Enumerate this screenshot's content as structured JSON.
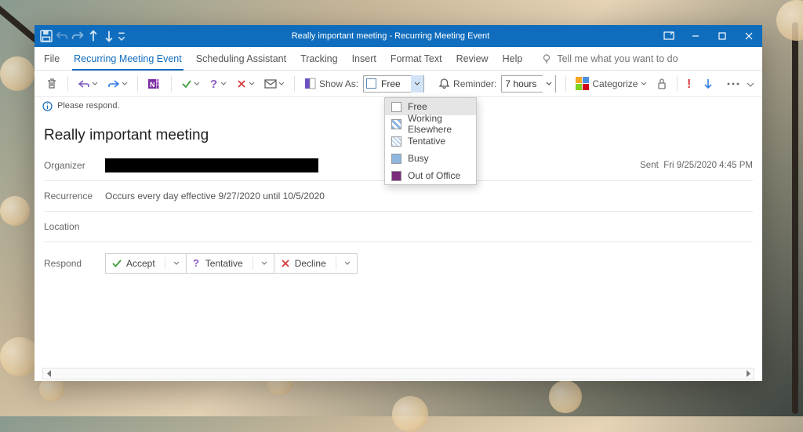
{
  "titlebar": {
    "title": "Really important meeting  -  Recurring Meeting Event"
  },
  "menubar": {
    "items": [
      {
        "label": "File"
      },
      {
        "label": "Recurring Meeting Event"
      },
      {
        "label": "Scheduling Assistant"
      },
      {
        "label": "Tracking"
      },
      {
        "label": "Insert"
      },
      {
        "label": "Format Text"
      },
      {
        "label": "Review"
      },
      {
        "label": "Help"
      }
    ],
    "tell_me_placeholder": "Tell me what you want to do"
  },
  "ribbon": {
    "show_as_label": "Show As:",
    "show_as_value": "Free",
    "reminder_label": "Reminder:",
    "reminder_value": "7 hours",
    "categorize_label": "Categorize"
  },
  "show_as_options": [
    {
      "label": "Free"
    },
    {
      "label": "Working Elsewhere"
    },
    {
      "label": "Tentative"
    },
    {
      "label": "Busy"
    },
    {
      "label": "Out of Office"
    }
  ],
  "info_strip": "Please respond.",
  "meeting": {
    "subject": "Really important meeting",
    "organizer_label": "Organizer",
    "recurrence_label": "Recurrence",
    "recurrence_value": "Occurs every day effective 9/27/2020 until 10/5/2020",
    "location_label": "Location",
    "respond_label": "Respond",
    "sent_label": "Sent",
    "sent_value": "Fri 9/25/2020 4:45 PM"
  },
  "respond": {
    "accept": "Accept",
    "tentative": "Tentative",
    "decline": "Decline"
  }
}
